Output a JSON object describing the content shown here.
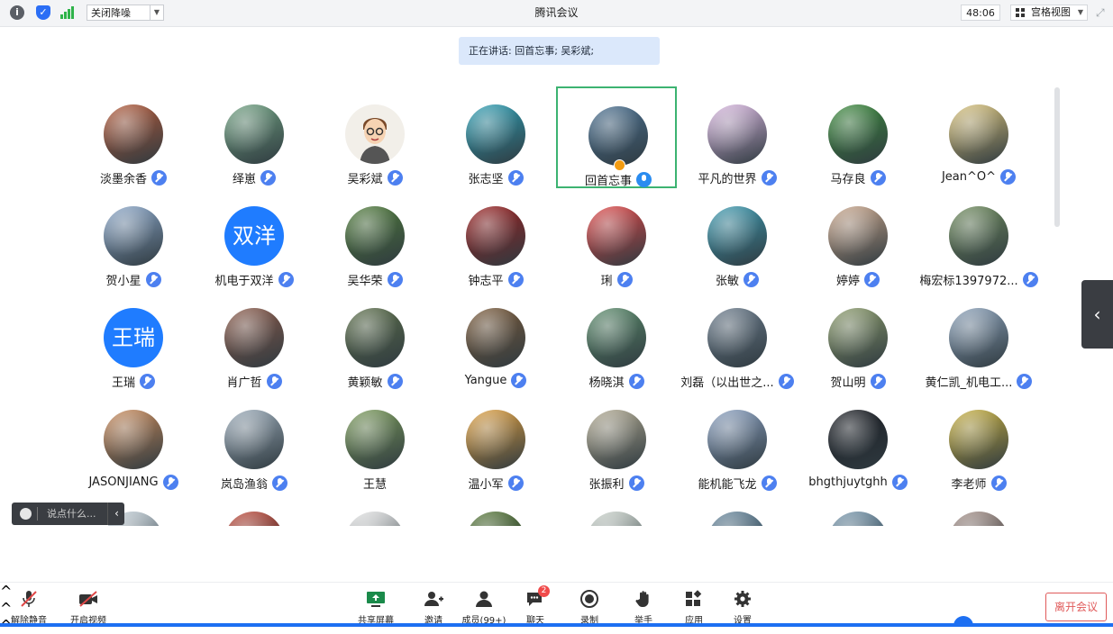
{
  "window": {
    "title": "腾讯会议"
  },
  "topbar": {
    "noise_label": "关闭降噪",
    "timer": "48:06",
    "view_label": "宫格视图"
  },
  "speaking": {
    "text": "正在讲话: 回首忘事; 吴彩斌;"
  },
  "participants": [
    {
      "name": "淡墨余香",
      "avatar": "photo",
      "color": "#b35a3a"
    },
    {
      "name": "绎崽",
      "avatar": "photo",
      "color": "#6fa080"
    },
    {
      "name": "吴彩斌",
      "avatar": "cartoon",
      "color": "#f2efe9"
    },
    {
      "name": "张志坚",
      "avatar": "photo",
      "color": "#2e9fb4"
    },
    {
      "name": "回首忘事",
      "avatar": "photo",
      "color": "#4a6f8f",
      "speaking": true,
      "host": true
    },
    {
      "name": "平凡的世界",
      "avatar": "photo",
      "color": "#d9b7e0"
    },
    {
      "name": "马存良",
      "avatar": "photo",
      "color": "#3c8a3c"
    },
    {
      "name": "Jean^O^",
      "avatar": "photo",
      "color": "#d9c27a"
    },
    {
      "name": "贺小星",
      "avatar": "photo",
      "color": "#8aa6c8"
    },
    {
      "name": "机电于双洋",
      "avatar": "text",
      "avatar_text": "双洋",
      "color": "#1f7cff"
    },
    {
      "name": "吴华荣",
      "avatar": "photo",
      "color": "#4f7a3a"
    },
    {
      "name": "钟志平",
      "avatar": "photo",
      "color": "#9a2020"
    },
    {
      "name": "琍",
      "avatar": "photo",
      "color": "#e04848"
    },
    {
      "name": "张敏",
      "avatar": "photo",
      "color": "#3d9ab0"
    },
    {
      "name": "婷婷",
      "avatar": "photo",
      "color": "#c9a58a"
    },
    {
      "name": "梅宏标1397972...",
      "avatar": "photo",
      "color": "#6e8a5c"
    },
    {
      "name": "王瑞",
      "avatar": "text",
      "avatar_text": "王瑞",
      "color": "#1f7cff"
    },
    {
      "name": "肖广哲",
      "avatar": "photo",
      "color": "#8a5a4a"
    },
    {
      "name": "黄颖敏",
      "avatar": "photo",
      "color": "#5c6e4a"
    },
    {
      "name": "Yangue",
      "avatar": "photo",
      "color": "#7a5a3a"
    },
    {
      "name": "杨晓淇",
      "avatar": "photo",
      "color": "#5a8a6a"
    },
    {
      "name": "刘磊（以出世之...",
      "avatar": "photo",
      "color": "#6a7a8a"
    },
    {
      "name": "贺山明",
      "avatar": "photo",
      "color": "#8a9a6a"
    },
    {
      "name": "黄仁凯_机电工...",
      "avatar": "photo",
      "color": "#8aa0b8"
    },
    {
      "name": "JASONJIANG",
      "avatar": "photo",
      "color": "#c98a5a"
    },
    {
      "name": "岚岛渔翁",
      "avatar": "photo",
      "color": "#9aaab8"
    },
    {
      "name": "王慧",
      "avatar": "photo",
      "color": "#7a9a5a",
      "no_mic": true
    },
    {
      "name": "温小军",
      "avatar": "photo",
      "color": "#e0a040"
    },
    {
      "name": "张振利",
      "avatar": "photo",
      "color": "#b0a890"
    },
    {
      "name": "能机能飞龙",
      "avatar": "photo",
      "color": "#8aa0c0"
    },
    {
      "name": "bhgthjuytghh",
      "avatar": "photo",
      "color": "#1a1c22"
    },
    {
      "name": "李老师",
      "avatar": "photo",
      "color": "#c8b040"
    },
    {
      "name": "",
      "avatar": "photo",
      "color": "#c8d4dc"
    },
    {
      "name": "",
      "avatar": "photo",
      "color": "#c24a3a"
    },
    {
      "name": "",
      "avatar": "photo",
      "color": "#eaeaea"
    },
    {
      "name": "",
      "avatar": "photo",
      "color": "#5a7a3a"
    },
    {
      "name": "",
      "avatar": "photo",
      "color": "#d0d8d0"
    },
    {
      "name": "",
      "avatar": "photo",
      "color": "#6a8aa0"
    },
    {
      "name": "",
      "avatar": "photo",
      "color": "#7a9ab0"
    },
    {
      "name": "",
      "avatar": "photo",
      "color": "#a8928a"
    }
  ],
  "chat": {
    "placeholder": "说点什么..."
  },
  "toolbar": {
    "unmute": "解除静音",
    "start_video": "开启视频",
    "share_screen": "共享屏幕",
    "invite": "邀请",
    "members": "成员(99+)",
    "chat": "聊天",
    "chat_badge": "2",
    "record": "录制",
    "raise_hand": "举手",
    "apps": "应用",
    "settings": "设置",
    "leave": "离开会议"
  }
}
